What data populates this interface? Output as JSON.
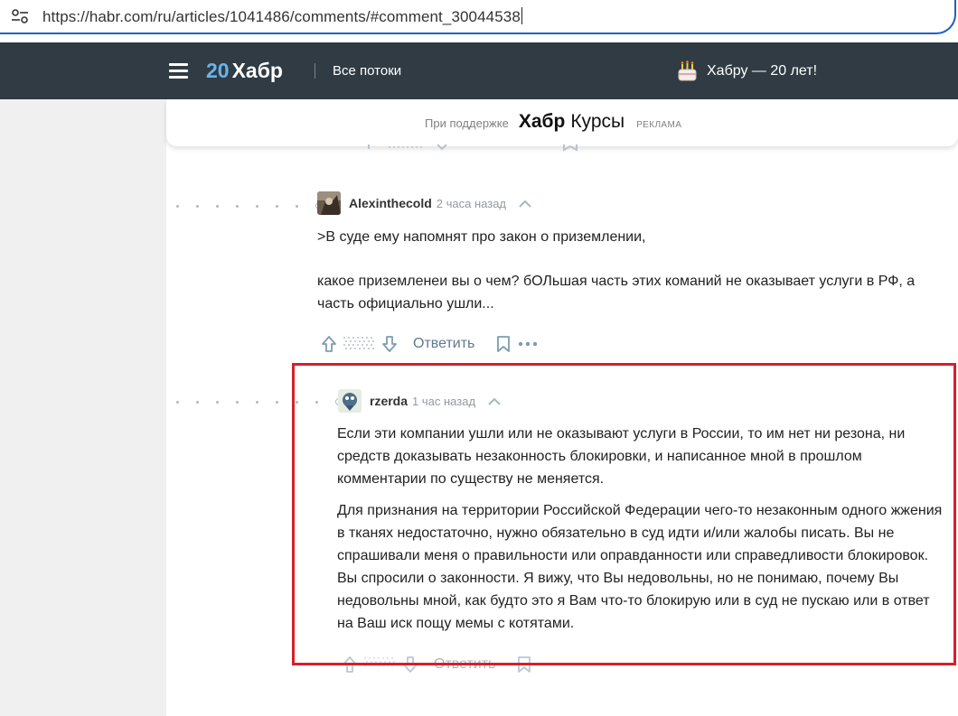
{
  "browser": {
    "url": "https://habr.com/ru/articles/1041486/comments/#comment_30044538"
  },
  "nav": {
    "logo_number": "20",
    "logo_name": "Хабр",
    "all_flows": "Все потоки",
    "anniversary": "Хабру — 20 лет!"
  },
  "sponsor": {
    "label": "При поддержке",
    "brand": "Хабр",
    "product": "Курсы",
    "ad": "РЕКЛАМА"
  },
  "comments": [
    {
      "author": "Alexinthecold",
      "time": "2 часа назад",
      "paragraphs": [
        ">В суде ему напомнят про закон о приземлении,",
        "какое приземленеи вы о чем? бОЛьшая часть этих команий не оказывает услуги в РФ, а часть официально ушли..."
      ],
      "reply": "Ответить"
    },
    {
      "author": "rzerda",
      "time": "1 час назад",
      "paragraphs": [
        "Если эти компании ушли или не оказывают услуги в России, то им нет ни резона, ни средств доказывать незаконность блокировки, и написанное мной в прошлом комментарии по существу не меняется.",
        "Для признания на территории Российской Федерации чего-то незаконным одного жжения в тканях недостаточно, нужно обязательно в суд идти и/или жалобы писать. Вы не спрашивали меня о правильности или оправданности или справедливости блокировок. Вы спросили о законности. Я вижу, что Вы недовольны, но не понимаю, почему Вы недовольны мной, как будто это я Вам что-то блокирую или в суд не пускаю или в ответ на Ваш иск пощу мемы с котятами."
      ],
      "reply": "Ответить"
    }
  ],
  "colors": {
    "nav_bg": "#303b44",
    "highlight": "#d71f2a",
    "link": "#5e7a91"
  }
}
